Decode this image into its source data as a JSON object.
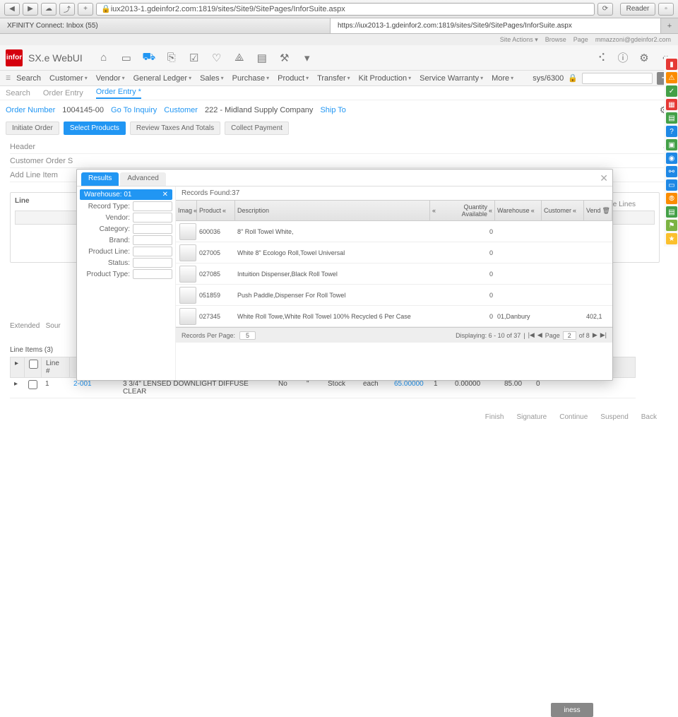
{
  "chrome": {
    "url": "iux2013-1.gdeinfor2.com:1819/sites/Site9/SitePages/InforSuite.aspx",
    "reader": "Reader"
  },
  "browser_tabs": {
    "t1": "XFINITY Connect: Inbox (55)",
    "t2": "https://iux2013-1.gdeinfor2.com:1819/sites/Site9/SitePages/InforSuite.aspx"
  },
  "top_strip": {
    "site_actions": "Site Actions ▾",
    "browse": "Browse",
    "page": "Page",
    "user": "mmazzoni@gdeinfor2.com"
  },
  "hdr": {
    "logo": "infor",
    "app": "SX.e WebUI"
  },
  "menubar": {
    "items": [
      "Search",
      "Customer",
      "Vendor",
      "General Ledger",
      "Sales",
      "Purchase",
      "Product",
      "Transfer",
      "Kit Production",
      "Service Warranty",
      "More"
    ],
    "sys": "sys/6300"
  },
  "subtabs": {
    "a": "Search",
    "b": "Order Entry",
    "c": "Order Entry *"
  },
  "order": {
    "label": "Order Number",
    "num": "1004145-00",
    "goto": "Go To Inquiry",
    "customer": "Customer",
    "cust_id": "222 - Midland Supply Company",
    "shipto": "Ship To"
  },
  "steps": {
    "s1": "Initiate Order",
    "s2": "Select Products",
    "s3": "Review Taxes And Totals",
    "s4": "Collect Payment"
  },
  "sections": {
    "header": "Header",
    "cos": "Customer Order S",
    "addline": "Add Line Item",
    "line": "Line",
    "ext": "Extended",
    "sour": "Sour",
    "le": "le Lines",
    "line_items": "Line Items (3)"
  },
  "modal": {
    "tab_results": "Results",
    "tab_adv": "Advanced",
    "warehouse_label": "Warehouse:",
    "warehouse": "01",
    "filters": [
      "Record Type:",
      "Vendor:",
      "Category:",
      "Brand:",
      "Product Line:",
      "Status:",
      "Product Type:"
    ],
    "records_found": "Records Found:37",
    "cols": {
      "img": "Imag",
      "prod": "Product",
      "desc": "Description",
      "qty": "Quantity Available",
      "wh": "Warehouse",
      "cust": "Customer",
      "vend": "Vend"
    },
    "rows": [
      {
        "p": "600036",
        "d": "8\" Roll Towel White,",
        "q": "0",
        "w": "<empty>",
        "c": "<empty>",
        "v": ""
      },
      {
        "p": "027005",
        "d": "White 8\" Ecologo Roll,Towel Universal",
        "q": "0",
        "w": "<empty>",
        "c": "<empty>",
        "v": ""
      },
      {
        "p": "027085",
        "d": "Intuition Dispenser,Black Roll Towel",
        "q": "0",
        "w": "<empty>",
        "c": "<empty>",
        "v": ""
      },
      {
        "p": "051859",
        "d": "Push Paddle,Dispenser For Roll Towel",
        "q": "0",
        "w": "<empty>",
        "c": "<empty>",
        "v": ""
      },
      {
        "p": "027345",
        "d": "White Roll Towe,White Roll Towel 100% Recycled 6 Per Case",
        "q": "0",
        "w": "01,Danbury",
        "c": "<empty>",
        "v": "402,1"
      }
    ],
    "rpp": "Records Per Page:",
    "rpp_val": "5",
    "displaying": "Displaying:  6 - 10  of 37",
    "page": "Page",
    "page_num": "2",
    "of": "of 8"
  },
  "table": {
    "h_sel": "",
    "h_line": "Line #",
    "r1_n": "1",
    "r1_p": "2-001",
    "r1_d": "3 3/4\" LENSED DOWNLIGHT DIFFUSE CLEAR",
    "r1_a": "No",
    "r1_b": "Stock",
    "r1_c": "each",
    "r1_d2": "65.00000",
    "r1_e": "1",
    "r1_f": "0.00000",
    "r1_g": "85.00",
    "r1_h": "0",
    "iness": "iness"
  },
  "footer": {
    "finish": "Finish",
    "sign": "Signature",
    "cont": "Continue",
    "susp": "Suspend",
    "back": "Back"
  }
}
